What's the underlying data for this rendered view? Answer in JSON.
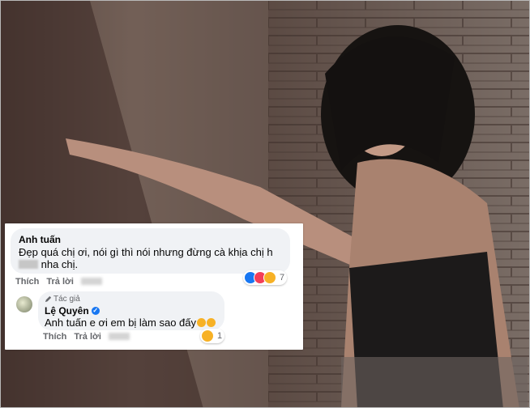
{
  "colors": {
    "facebook_blue": "#1877f2",
    "bubble_bg": "#f0f2f5",
    "secondary_text": "#65676b"
  },
  "comment": {
    "author": "Anh tuấn",
    "text_before_redaction": "Đẹp quá chị ơi, nói gì thì nói nhưng đừng cà khịa chị h",
    "text_after_redaction": " nha chị.",
    "actions": {
      "like": "Thích",
      "reply": "Trả lời"
    },
    "reaction_icons": [
      "like-icon",
      "love-icon",
      "haha-icon"
    ],
    "reaction_count": "7"
  },
  "reply": {
    "badge": "Tác giả",
    "author": "Lệ Quyên",
    "verified_icon": "verified-icon",
    "text": "Anh tuấn e ơi em bị làm sao đấy",
    "actions": {
      "like": "Thích",
      "reply": "Trả lời"
    },
    "reaction_icons": [
      "haha-icon"
    ],
    "reaction_count": "1"
  }
}
